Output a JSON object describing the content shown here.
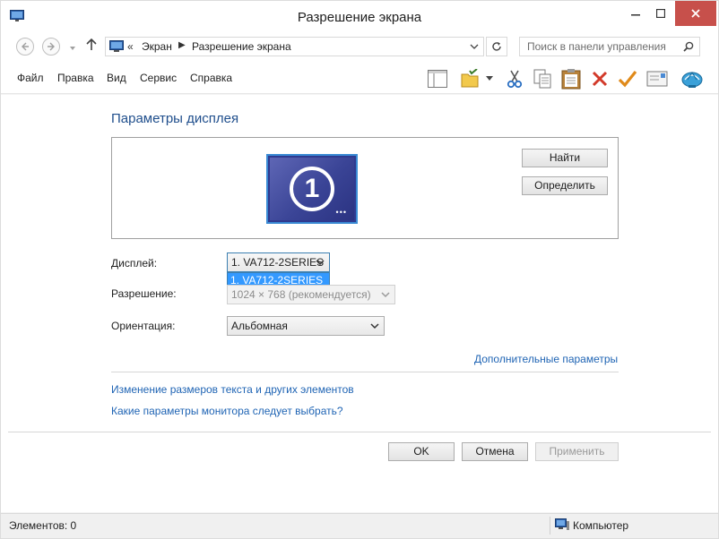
{
  "window": {
    "title": "Разрешение экрана"
  },
  "address_bar": {
    "separator": "«",
    "breadcrumbs": [
      "Экран",
      "Разрешение экрана"
    ],
    "crumb_separator": "▶",
    "search_placeholder": "Поиск в панели управления"
  },
  "menu": {
    "items": [
      "Файл",
      "Правка",
      "Вид",
      "Сервис",
      "Справка"
    ]
  },
  "toolbar_icons": [
    "layout-icon",
    "folder-options-icon",
    "cut-icon",
    "copy-icon",
    "paste-icon",
    "delete-icon",
    "check-icon",
    "email-icon",
    "shell-icon"
  ],
  "main": {
    "heading": "Параметры дисплея",
    "monitor_number": "1",
    "monitor_dots": "•••",
    "find_button": "Найти",
    "identify_button": "Определить",
    "display_label": "Дисплей:",
    "display_value": "1. VA712-2SERIES",
    "display_dropdown_option": "1. VA712-2SERIES",
    "resolution_label": "Разрешение:",
    "resolution_value": "1024 × 768 (рекомендуется)",
    "orientation_label": "Ориентация:",
    "orientation_value": "Альбомная",
    "advanced_link": "Дополнительные параметры",
    "text_size_link": "Изменение размеров текста и других элементов",
    "monitor_help_link": "Какие параметры монитора следует выбрать?",
    "ok_button": "OK",
    "cancel_button": "Отмена",
    "apply_button": "Применить"
  },
  "status_bar": {
    "items_text": "Элементов: 0",
    "location_text": "Компьютер"
  },
  "colors": {
    "accent_link": "#1f64b4",
    "heading": "#1f4e8c",
    "close_button": "#c7504b",
    "selection": "#3399ff"
  }
}
